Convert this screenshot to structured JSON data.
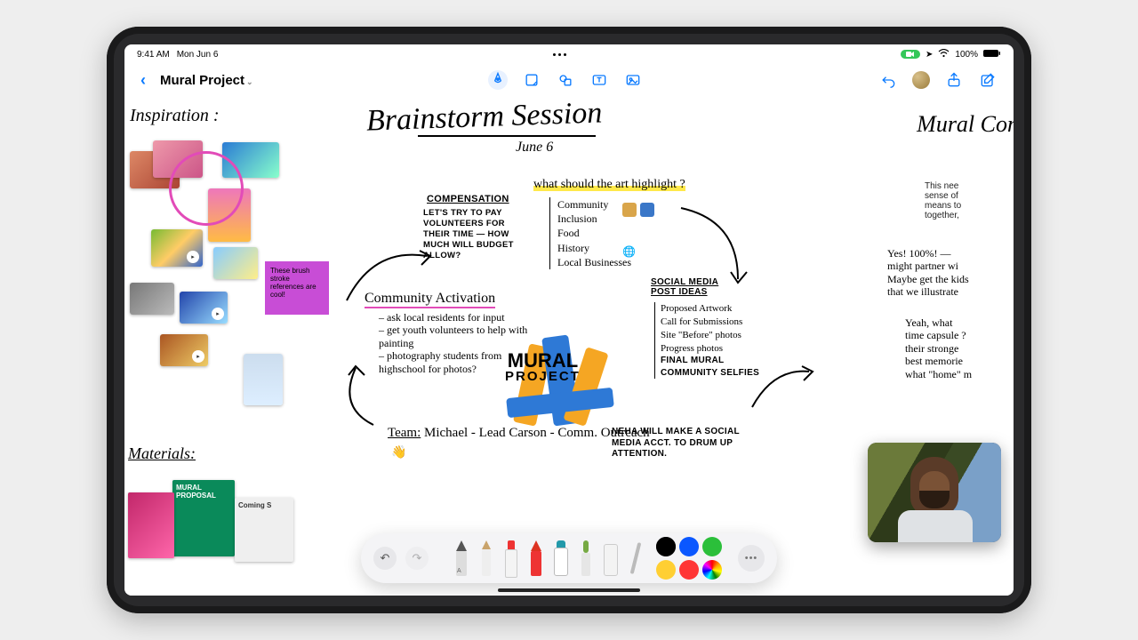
{
  "status": {
    "time": "9:41 AM",
    "date": "Mon Jun 6",
    "battery_pct": "100%",
    "facetime_pill": "📹"
  },
  "nav": {
    "back": "‹",
    "title": "Mural Project",
    "tools": {
      "pen": "pen-tip-icon",
      "sticky": "sticky-note-icon",
      "shapes": "shapes-icon",
      "text": "textbox-icon",
      "media": "photo-icon"
    },
    "actions": {
      "undo": "undo-icon",
      "share": "share-icon",
      "compose": "compose-icon"
    }
  },
  "canvas": {
    "inspiration_heading": "Inspiration :",
    "sticky_note": "These brush stroke references are cool!",
    "title_main": "Brainstorm Session",
    "title_sub": "June 6",
    "compensation": {
      "heading": "COMPENSATION",
      "body": "LET'S TRY TO PAY VOLUNTEERS FOR THEIR TIME — HOW MUCH WILL BUDGET ALLOW?"
    },
    "highlight_q": "what should the art highlight ?",
    "highlight_items": [
      "Community",
      "Inclusion",
      "Food",
      "History",
      "Local Businesses"
    ],
    "activation": {
      "heading": "Community Activation",
      "items": [
        "ask local residents for input",
        "get youth volunteers to help with painting",
        "photography students from highschool for photos?"
      ]
    },
    "mural_logo": {
      "line1": "MURAL",
      "line2": "PROJECT"
    },
    "social": {
      "heading": "SOCIAL MEDIA POST IDEAS",
      "items": [
        "Proposed Artwork",
        "Call for Submissions",
        "Site \"Before\" photos",
        "Progress photos",
        "FINAL MURAL",
        "COMMUNITY SELFIES"
      ]
    },
    "team": {
      "heading": "Team:",
      "line": "Michael - Lead   Carson - Comm. Outreach"
    },
    "neha": "NEHA WILL MAKE A SOCIAL MEDIA ACCT. TO DRUM UP ATTENTION.",
    "right_heading": "Mural Con",
    "right_para": "This nee\nsense of\nmeans to\ntogether,",
    "right_yes": "Yes! 100%! —\nmight partner wi\nMaybe get the kids\nthat we illustrate",
    "right_yeah": "Yeah, what\ntime capsule ?\ntheir stronge\nbest memorie\nwhat \"home\" m",
    "materials_heading": "Materials:",
    "books": {
      "mural": "MURAL PROPOSAL",
      "coming": "Coming S"
    }
  },
  "dock": {
    "undo": "↶",
    "redo": "↷",
    "tools": [
      "pen",
      "pencil",
      "marker",
      "crayon",
      "paint",
      "brush",
      "eraser",
      "ruler"
    ],
    "colors": [
      "#000000",
      "#0a57ff",
      "#2bbf3a",
      "#ffcf33",
      "#ff3535",
      "rainbow"
    ],
    "selected_color": "#000000",
    "more": "•••"
  }
}
